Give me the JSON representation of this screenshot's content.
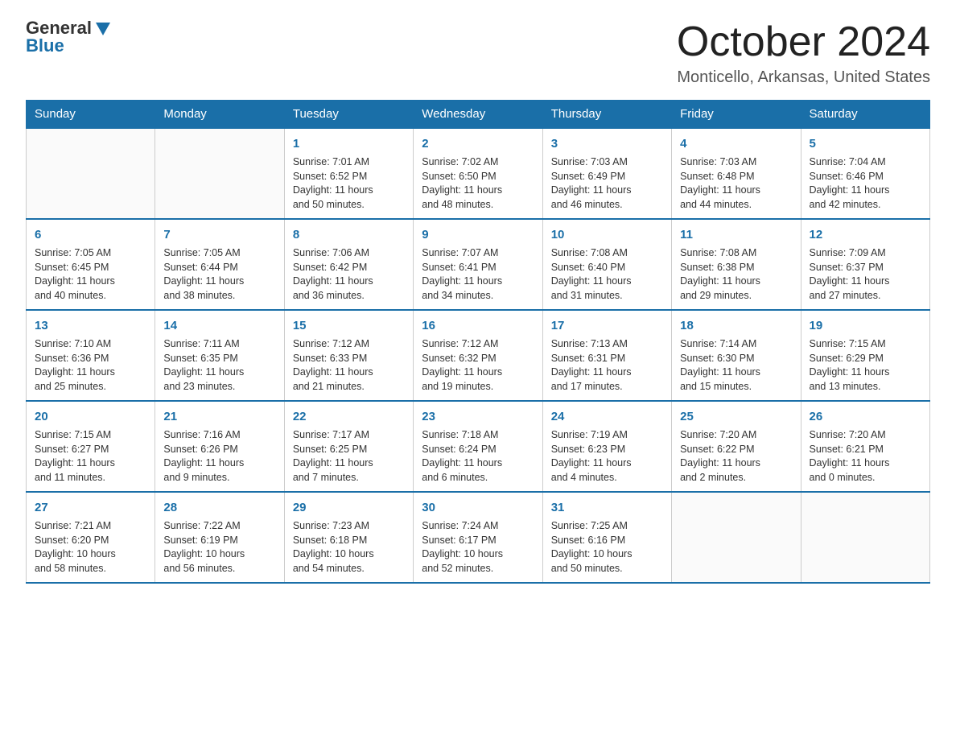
{
  "header": {
    "logo": {
      "line1": "General",
      "line2": "Blue"
    },
    "month_title": "October 2024",
    "location": "Monticello, Arkansas, United States"
  },
  "calendar": {
    "days_of_week": [
      "Sunday",
      "Monday",
      "Tuesday",
      "Wednesday",
      "Thursday",
      "Friday",
      "Saturday"
    ],
    "weeks": [
      [
        {
          "day": "",
          "info": ""
        },
        {
          "day": "",
          "info": ""
        },
        {
          "day": "1",
          "info": "Sunrise: 7:01 AM\nSunset: 6:52 PM\nDaylight: 11 hours\nand 50 minutes."
        },
        {
          "day": "2",
          "info": "Sunrise: 7:02 AM\nSunset: 6:50 PM\nDaylight: 11 hours\nand 48 minutes."
        },
        {
          "day": "3",
          "info": "Sunrise: 7:03 AM\nSunset: 6:49 PM\nDaylight: 11 hours\nand 46 minutes."
        },
        {
          "day": "4",
          "info": "Sunrise: 7:03 AM\nSunset: 6:48 PM\nDaylight: 11 hours\nand 44 minutes."
        },
        {
          "day": "5",
          "info": "Sunrise: 7:04 AM\nSunset: 6:46 PM\nDaylight: 11 hours\nand 42 minutes."
        }
      ],
      [
        {
          "day": "6",
          "info": "Sunrise: 7:05 AM\nSunset: 6:45 PM\nDaylight: 11 hours\nand 40 minutes."
        },
        {
          "day": "7",
          "info": "Sunrise: 7:05 AM\nSunset: 6:44 PM\nDaylight: 11 hours\nand 38 minutes."
        },
        {
          "day": "8",
          "info": "Sunrise: 7:06 AM\nSunset: 6:42 PM\nDaylight: 11 hours\nand 36 minutes."
        },
        {
          "day": "9",
          "info": "Sunrise: 7:07 AM\nSunset: 6:41 PM\nDaylight: 11 hours\nand 34 minutes."
        },
        {
          "day": "10",
          "info": "Sunrise: 7:08 AM\nSunset: 6:40 PM\nDaylight: 11 hours\nand 31 minutes."
        },
        {
          "day": "11",
          "info": "Sunrise: 7:08 AM\nSunset: 6:38 PM\nDaylight: 11 hours\nand 29 minutes."
        },
        {
          "day": "12",
          "info": "Sunrise: 7:09 AM\nSunset: 6:37 PM\nDaylight: 11 hours\nand 27 minutes."
        }
      ],
      [
        {
          "day": "13",
          "info": "Sunrise: 7:10 AM\nSunset: 6:36 PM\nDaylight: 11 hours\nand 25 minutes."
        },
        {
          "day": "14",
          "info": "Sunrise: 7:11 AM\nSunset: 6:35 PM\nDaylight: 11 hours\nand 23 minutes."
        },
        {
          "day": "15",
          "info": "Sunrise: 7:12 AM\nSunset: 6:33 PM\nDaylight: 11 hours\nand 21 minutes."
        },
        {
          "day": "16",
          "info": "Sunrise: 7:12 AM\nSunset: 6:32 PM\nDaylight: 11 hours\nand 19 minutes."
        },
        {
          "day": "17",
          "info": "Sunrise: 7:13 AM\nSunset: 6:31 PM\nDaylight: 11 hours\nand 17 minutes."
        },
        {
          "day": "18",
          "info": "Sunrise: 7:14 AM\nSunset: 6:30 PM\nDaylight: 11 hours\nand 15 minutes."
        },
        {
          "day": "19",
          "info": "Sunrise: 7:15 AM\nSunset: 6:29 PM\nDaylight: 11 hours\nand 13 minutes."
        }
      ],
      [
        {
          "day": "20",
          "info": "Sunrise: 7:15 AM\nSunset: 6:27 PM\nDaylight: 11 hours\nand 11 minutes."
        },
        {
          "day": "21",
          "info": "Sunrise: 7:16 AM\nSunset: 6:26 PM\nDaylight: 11 hours\nand 9 minutes."
        },
        {
          "day": "22",
          "info": "Sunrise: 7:17 AM\nSunset: 6:25 PM\nDaylight: 11 hours\nand 7 minutes."
        },
        {
          "day": "23",
          "info": "Sunrise: 7:18 AM\nSunset: 6:24 PM\nDaylight: 11 hours\nand 6 minutes."
        },
        {
          "day": "24",
          "info": "Sunrise: 7:19 AM\nSunset: 6:23 PM\nDaylight: 11 hours\nand 4 minutes."
        },
        {
          "day": "25",
          "info": "Sunrise: 7:20 AM\nSunset: 6:22 PM\nDaylight: 11 hours\nand 2 minutes."
        },
        {
          "day": "26",
          "info": "Sunrise: 7:20 AM\nSunset: 6:21 PM\nDaylight: 11 hours\nand 0 minutes."
        }
      ],
      [
        {
          "day": "27",
          "info": "Sunrise: 7:21 AM\nSunset: 6:20 PM\nDaylight: 10 hours\nand 58 minutes."
        },
        {
          "day": "28",
          "info": "Sunrise: 7:22 AM\nSunset: 6:19 PM\nDaylight: 10 hours\nand 56 minutes."
        },
        {
          "day": "29",
          "info": "Sunrise: 7:23 AM\nSunset: 6:18 PM\nDaylight: 10 hours\nand 54 minutes."
        },
        {
          "day": "30",
          "info": "Sunrise: 7:24 AM\nSunset: 6:17 PM\nDaylight: 10 hours\nand 52 minutes."
        },
        {
          "day": "31",
          "info": "Sunrise: 7:25 AM\nSunset: 6:16 PM\nDaylight: 10 hours\nand 50 minutes."
        },
        {
          "day": "",
          "info": ""
        },
        {
          "day": "",
          "info": ""
        }
      ]
    ]
  }
}
